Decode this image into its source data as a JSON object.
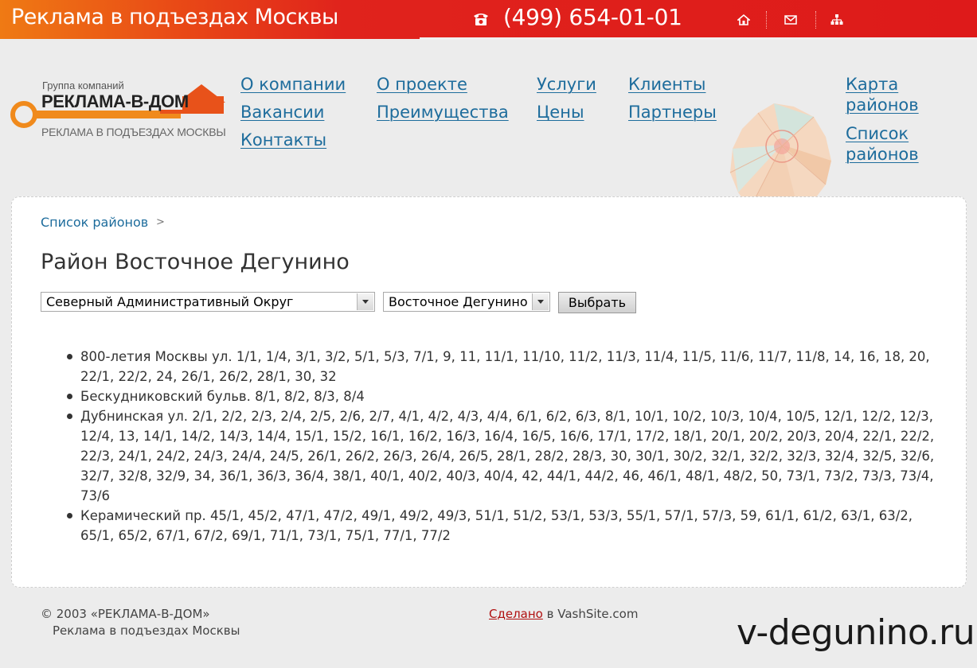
{
  "topbar": {
    "site_title": "Реклама в подъездах Москвы",
    "phone": "(499) 654-01-01",
    "icons": [
      "phone-icon",
      "home-icon",
      "mail-icon",
      "sitemap-icon"
    ],
    "bg_color": "#de1a1a"
  },
  "logo": {
    "group": "Группа компаний",
    "name": "РЕКЛАМА-В-ДОМ",
    "sub": "РЕКЛАМА В ПОДЪЕЗДАХ МОСКВЫ",
    "accent": "#e8521a"
  },
  "nav": {
    "about": "О компании",
    "vacancies": "Вакансии",
    "contacts": "Контакты",
    "project": "О проекте",
    "advantages": "Преимущества",
    "services": "Услуги",
    "prices": "Цены",
    "clients": "Клиенты",
    "partners": "Партнеры",
    "map_line1": "Карта",
    "map_line2": "районов",
    "list_line1": "Список",
    "list_line2": "районов"
  },
  "breadcrumb": {
    "label": "Список районов",
    "sep": ">"
  },
  "page_title": "Район Восточное Дегунино",
  "filters": {
    "okrug": "Северный Административный Округ",
    "district": "Восточное Дегунино",
    "button": "Выбрать"
  },
  "addresses": [
    "800-летия Москвы ул. 1/1, 1/4, 3/1, 3/2, 5/1, 5/3, 7/1, 9, 11, 11/1, 11/10, 11/2, 11/3, 11/4, 11/5, 11/6, 11/7, 11/8, 14, 16, 18, 20, 22/1, 22/2, 24, 26/1, 26/2, 28/1, 30, 32",
    "Бескудниковский бульв. 8/1, 8/2, 8/3, 8/4",
    "Дубнинская ул. 2/1, 2/2, 2/3, 2/4, 2/5, 2/6, 2/7, 4/1, 4/2, 4/3, 4/4, 6/1, 6/2, 6/3, 8/1, 10/1, 10/2, 10/3, 10/4, 10/5, 12/1, 12/2, 12/3, 12/4, 13, 14/1, 14/2, 14/3, 14/4, 15/1, 15/2, 16/1, 16/2, 16/3, 16/4, 16/5, 16/6, 17/1, 17/2, 18/1, 20/1, 20/2, 20/3, 20/4, 22/1, 22/2, 22/3, 24/1, 24/2, 24/3, 24/4, 24/5, 26/1, 26/2, 26/3, 26/4, 26/5, 28/1, 28/2, 28/3, 30, 30/1, 30/2, 32/1, 32/2, 32/3, 32/4, 32/5, 32/6, 32/7, 32/8, 32/9, 34, 36/1, 36/3, 36/4, 38/1, 40/1, 40/2, 40/3, 40/4, 42, 44/1, 44/2, 46, 46/1, 48/1, 48/2, 50, 73/1, 73/2, 73/3, 73/4, 73/6",
    "Керамический пр. 45/1, 45/2, 47/1, 47/2, 49/1, 49/2, 49/3, 51/1, 51/2, 53/1, 53/3, 55/1, 57/1, 57/3, 59, 61/1, 61/2, 63/1, 63/2, 65/1, 65/2, 67/1, 67/2, 69/1, 71/1, 73/1, 75/1, 77/1, 77/2"
  ],
  "footer": {
    "copyright": "© 2003 «РЕКЛАМА-В-ДОМ»",
    "copyright_sub": "Реклама в подъездах Москвы",
    "made_link": "Сделано",
    "made_rest": " в VashSite.com",
    "watermark": "v-degunino.ru"
  }
}
